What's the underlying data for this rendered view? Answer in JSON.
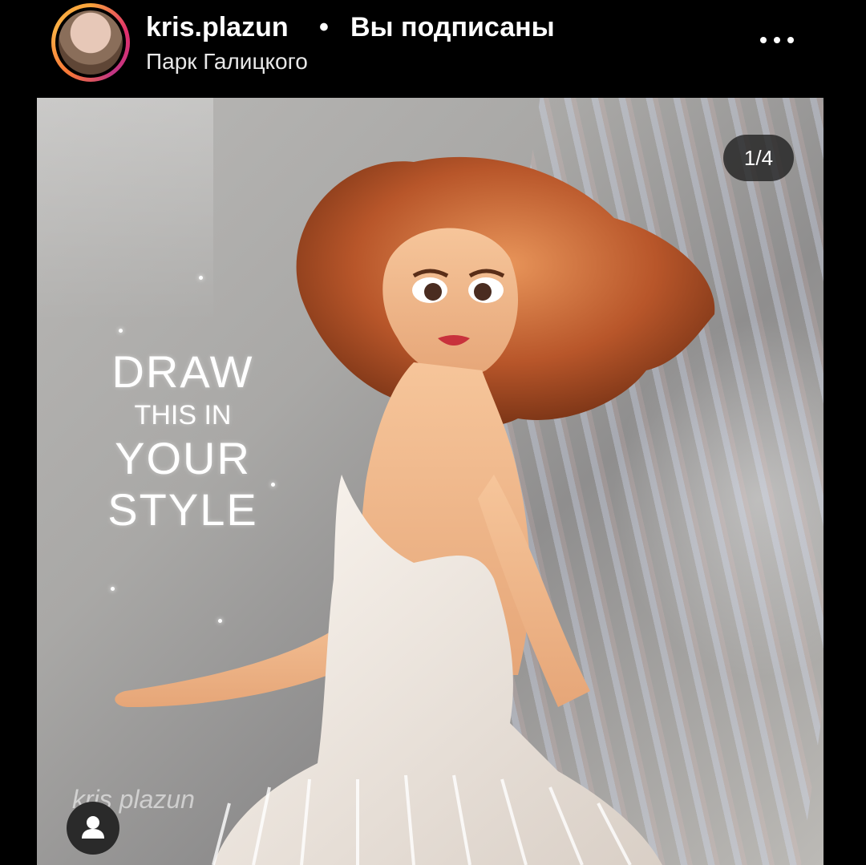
{
  "header": {
    "username": "kris.plazun",
    "separator": "•",
    "follow_status": "Вы подписаны",
    "location": "Парк Галицкого",
    "more_icon": "more-horizontal-icon"
  },
  "post": {
    "counter": "1/4",
    "artwork_text": {
      "line1": "DRAW",
      "line2": "THIS IN",
      "line3": "YOUR",
      "line4": "STYLE"
    },
    "signature": "kris plazun",
    "user_tag_icon": "user-tag-icon"
  },
  "colors": {
    "background": "#000000",
    "text": "#ffffff",
    "hair": "#b8562a",
    "dress": "#f2ece6"
  }
}
